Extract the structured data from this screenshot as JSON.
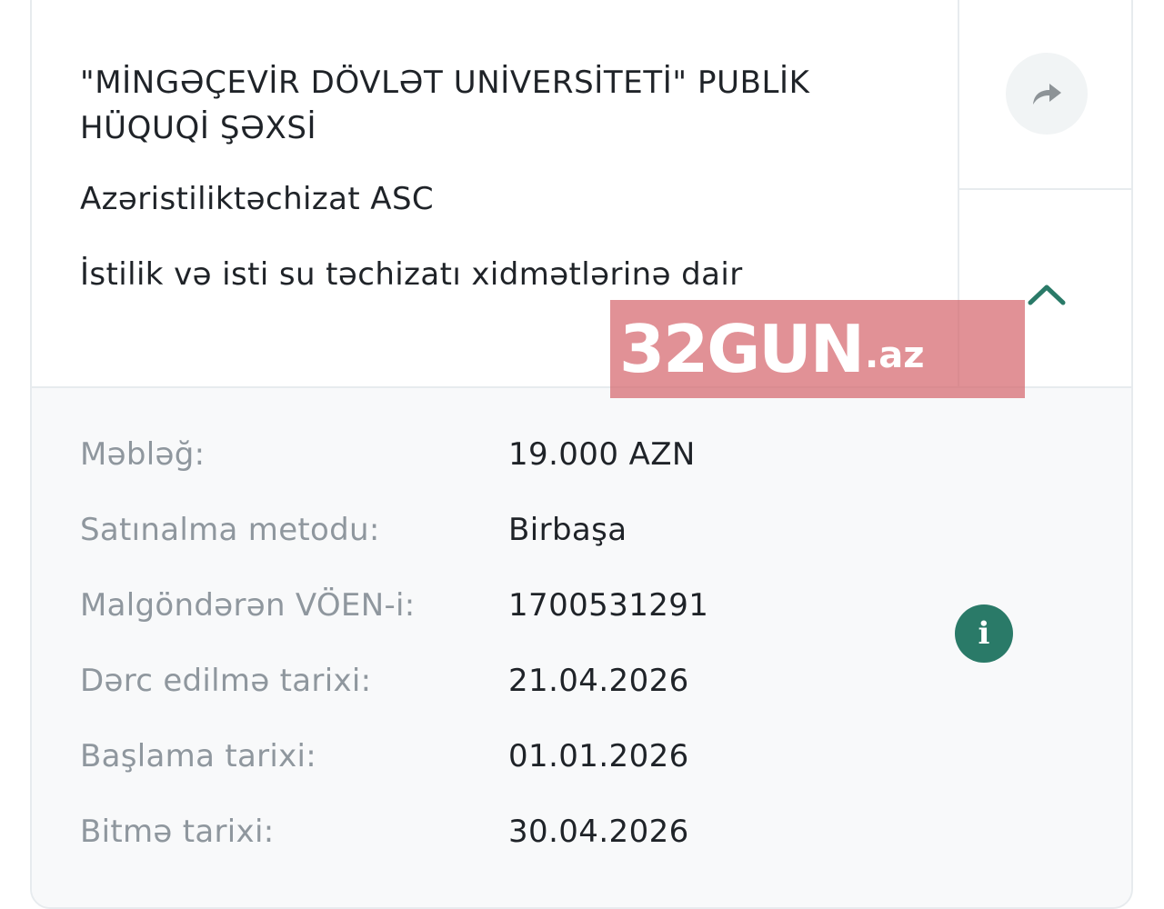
{
  "tender": {
    "buyer": "\"MİNGƏÇEVİR DÖVLƏT UNİVERSİTETİ\" PUBLİK HÜQUQİ ŞƏXSİ",
    "supplier": "Azəristiliktəchizat ASC",
    "subject": "İstilik və isti su təchizatı xidmətlərinə dair"
  },
  "actions": {
    "share_icon": "share-arrow-icon",
    "collapse_icon": "chevron-up-icon",
    "info_icon": "info-icon",
    "info_glyph": "i"
  },
  "details": [
    {
      "label": "Məbləğ:",
      "value": "19.000 AZN"
    },
    {
      "label": "Satınalma metodu:",
      "value": "Birbaşa"
    },
    {
      "label": "Malgöndərən VÖEN-i:",
      "value": "1700531291"
    },
    {
      "label": "Dərc edilmə tarixi:",
      "value": "21.04.2026"
    },
    {
      "label": "Başlama tarixi:",
      "value": "01.01.2026"
    },
    {
      "label": "Bitmə tarixi:",
      "value": "30.04.2026"
    }
  ],
  "watermark": {
    "main": "32GUN",
    "sub": ".az"
  },
  "colors": {
    "accent": "#2a7a68",
    "label": "#8f979e",
    "text": "#1f2328",
    "border": "#e7ebee",
    "details_bg": "#f8f9fa",
    "watermark_bg": "#d6676e"
  }
}
